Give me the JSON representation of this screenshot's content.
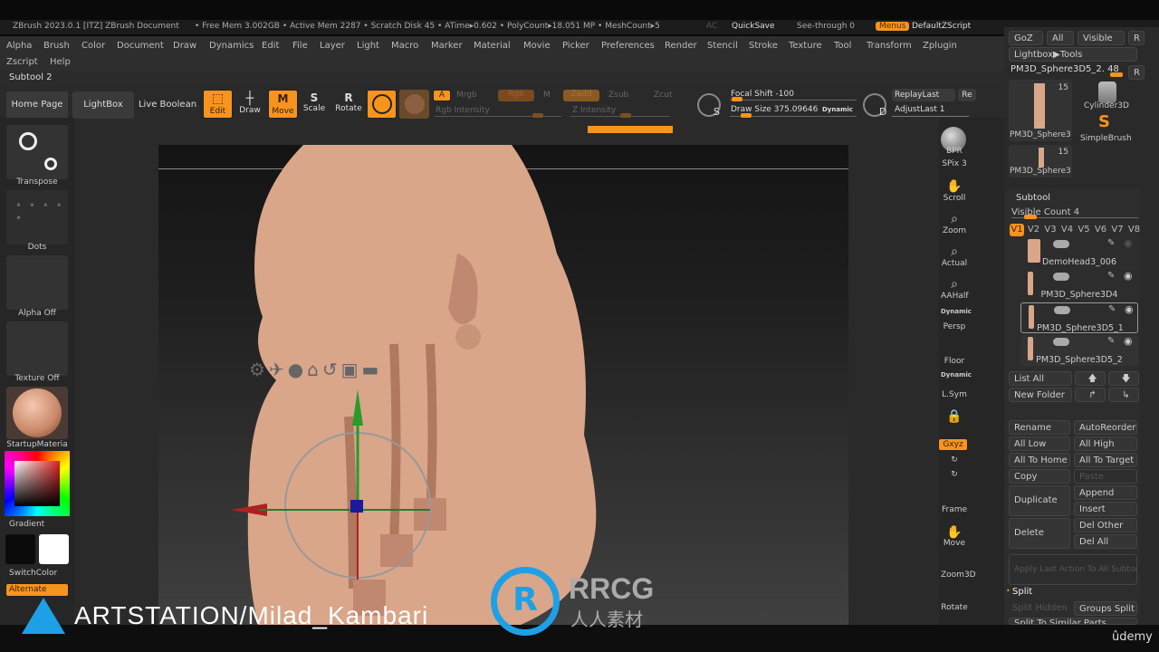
{
  "titlebar": {
    "app": "ZBrush 2023.0.1 [ITZ]  ZBrush Document",
    "stats": "• Free Mem 3.002GB • Active Mem 2287 • Scratch Disk 45 • ATime▸0.602 • PolyCount▸18.051 MP • MeshCount▸5",
    "ac": "AC",
    "quicksave": "QuickSave",
    "see_through": "See-through 0",
    "menus": "Menus",
    "default_zscript": "DefaultZScript"
  },
  "menus": [
    "Alpha",
    "Brush",
    "Color",
    "Document",
    "Draw",
    "Dynamics",
    "Edit",
    "File",
    "Layer",
    "Light",
    "Macro",
    "Marker",
    "Material",
    "Movie",
    "Picker",
    "Preferences",
    "Render",
    "Stencil",
    "Stroke",
    "Texture",
    "Tool",
    "Transform",
    "Zplugin"
  ],
  "menus_row2": [
    "Zscript",
    "Help"
  ],
  "subtool_title": "Subtool 2",
  "toolbar": {
    "home_page": "Home Page",
    "lightbox": "LightBox",
    "live_boolean": "Live Boolean",
    "edit": "Edit",
    "draw": "Draw",
    "move": "Move",
    "scale": "Scale",
    "rotate": "Rotate",
    "a": "A",
    "mrgb": "Mrgb",
    "rgb": "Rgb",
    "m": "M",
    "zadd": "Zadd",
    "zsub": "Zsub",
    "zcut": "Zcut",
    "rgb_intensity": "Rgb Intensity",
    "z_intensity": "Z Intensity",
    "focal_shift": "Focal Shift -100",
    "draw_size": "Draw Size 375.09646",
    "dynamic": "Dynamic",
    "replay_last": "ReplayLast",
    "re": "Re",
    "adjust_last": "AdjustLast 1",
    "s_key": "S",
    "d_key": "D"
  },
  "left": {
    "transpose": "Transpose",
    "dots": "Dots",
    "alpha_off": "Alpha Off",
    "texture_off": "Texture Off",
    "material": "StartupMateria",
    "gradient": "Gradient",
    "switch_color": "SwitchColor",
    "alternate": "Alternate"
  },
  "dock": {
    "bpr": "BPR",
    "spix": "SPix 3",
    "scroll": "Scroll",
    "zoom": "Zoom",
    "actual": "Actual",
    "aahalf": "AAHalf",
    "dynamic": "Dynamic",
    "persp": "Persp",
    "floor": "Floor",
    "lsym": "L.Sym",
    "xyz": "Gxyz",
    "frame": "Frame",
    "move": "Move",
    "zoom3d": "Zoom3D",
    "rotate": "Rotate"
  },
  "tool_panel": {
    "goz": "GoZ",
    "all": "All",
    "visible": "Visible",
    "r": "R",
    "lightbox_tools": "Lightbox▶Tools",
    "current_tool": "PM3D_Sphere3D5_2. 48",
    "thumbs": [
      {
        "name": "PM3D_Sphere3",
        "count": "15"
      },
      {
        "name": "Cylinder3D"
      },
      {
        "name": "SimpleBrush"
      },
      {
        "name": "PM3D_Sphere3",
        "count": "15"
      }
    ]
  },
  "subtool_panel": {
    "title": "Subtool",
    "visible_count": "Visible Count 4",
    "versions": [
      "V1",
      "V2",
      "V3",
      "V4",
      "V5",
      "V6",
      "V7",
      "V8"
    ],
    "items": [
      {
        "name": "DemoHead3_006"
      },
      {
        "name": "PM3D_Sphere3D4"
      },
      {
        "name": "PM3D_Sphere3D5_1"
      },
      {
        "name": "PM3D_Sphere3D5_2"
      }
    ],
    "list_all": "List All",
    "new_folder": "New Folder",
    "rename": "Rename",
    "auto_reorder": "AutoReorder",
    "all_low": "All Low",
    "all_high": "All High",
    "all_to_home": "All To Home",
    "all_to_target": "All To Target",
    "copy": "Copy",
    "paste": "Paste",
    "duplicate": "Duplicate",
    "append": "Append",
    "insert": "Insert",
    "delete": "Delete",
    "del_other": "Del Other",
    "del_all": "Del All",
    "apply_last": "Apply Last Action To All Subtoc",
    "split": "Split",
    "split_hidden": "Split Hidden",
    "groups_split": "Groups Split",
    "split_similar": "Split To Similar Parts"
  },
  "watermarks": {
    "artstation": "ARTSTATION/Milad_Kambari",
    "rrcg": "RRCG",
    "rrcg_cn": "人人素材",
    "udemy": "ûdemy"
  },
  "colors": {
    "accent": "#f7941e",
    "skin": "#d9a68a"
  }
}
